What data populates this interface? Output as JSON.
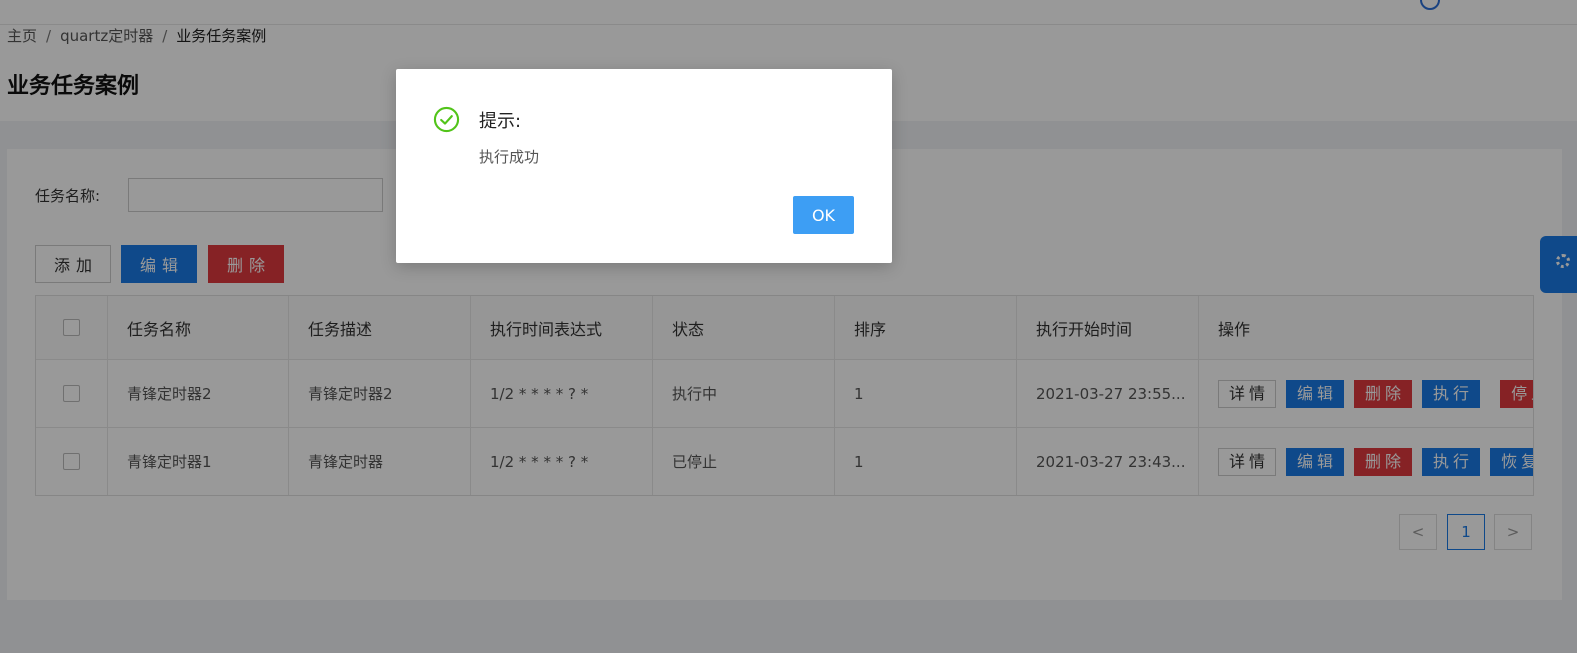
{
  "breadcrumb": {
    "home": "主页",
    "sep1": "/",
    "module": "quartz定时器",
    "sep2": "/",
    "current": "业务任务案例"
  },
  "page": {
    "title": "业务任务案例"
  },
  "search": {
    "label": "任务名称:",
    "value": ""
  },
  "toolbar": {
    "add_label": "添加",
    "edit_label": "编辑",
    "delete_label": "删除"
  },
  "table": {
    "columns": [
      "任务名称",
      "任务描述",
      "执行时间表达式",
      "状态",
      "排序",
      "执行开始时间",
      "操作"
    ],
    "rows": [
      {
        "name": "青锋定时器2",
        "desc": "青锋定时器2",
        "cron": "1/2 * * * * ? *",
        "status": "执行中",
        "order": "1",
        "start": "2021-03-27 23:55...",
        "ops": {
          "detail": "详情",
          "edit": "编辑",
          "delete": "删除",
          "exec": "执行",
          "toggle": "停止"
        }
      },
      {
        "name": "青锋定时器1",
        "desc": "青锋定时器",
        "cron": "1/2 * * * * ? *",
        "status": "已停止",
        "order": "1",
        "start": "2021-03-27 23:43...",
        "ops": {
          "detail": "详情",
          "edit": "编辑",
          "delete": "删除",
          "exec": "执行",
          "toggle": "恢复"
        }
      }
    ]
  },
  "pagination": {
    "prev": "<",
    "current": "1",
    "next": ">"
  },
  "dialog": {
    "title": "提示:",
    "message": "执行成功",
    "ok_label": "OK"
  },
  "colors": {
    "primary": "#1a7ae6",
    "danger": "#e0393f",
    "success": "#52c41a",
    "ok_button": "#3d9ef4"
  },
  "icons": {
    "dialog": "check-circle-icon",
    "side_tab": "gear-icon",
    "pager_prev": "chevron-left-icon",
    "pager_next": "chevron-right-icon"
  }
}
